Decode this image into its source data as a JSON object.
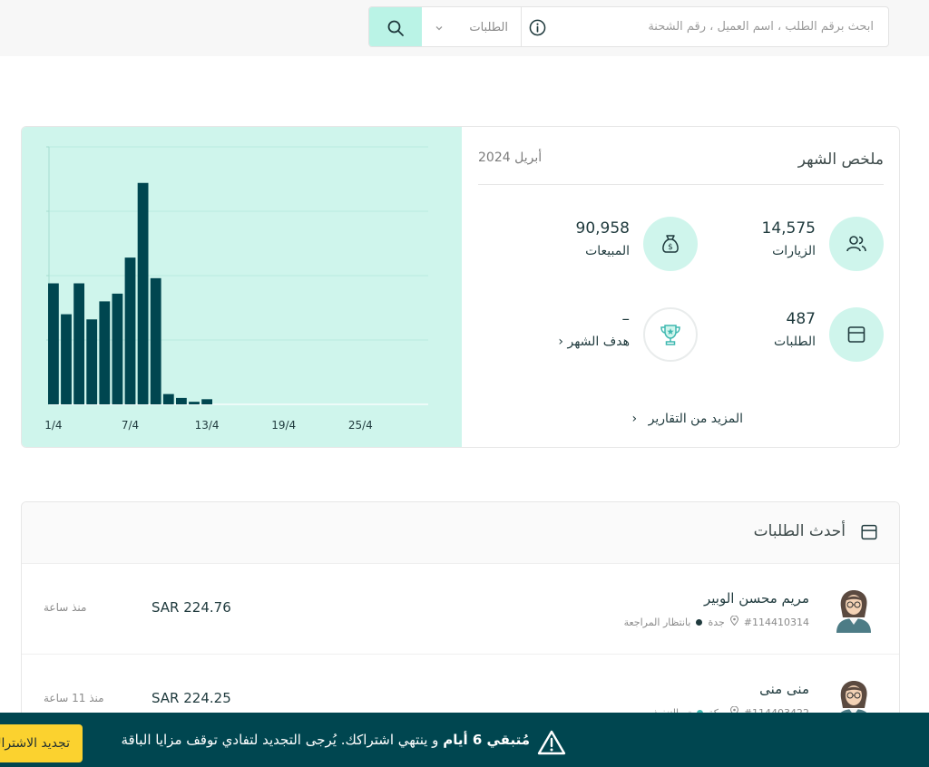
{
  "search": {
    "placeholder": "ابحث برقم الطلب ، اسم العميل ، رقم الشحنة",
    "scope_selected": "الطلبات",
    "button_icon": "search-icon",
    "info_icon": "info-icon"
  },
  "summary": {
    "title": "ملخص الشهر",
    "month": "أبريل 2024",
    "stats": {
      "visits": {
        "value": "14,575",
        "label": "الزيارات",
        "icon": "users-icon"
      },
      "sales": {
        "value": "90,958",
        "label": "المبيعات",
        "icon": "money-bag-icon"
      },
      "orders": {
        "value": "487",
        "label": "الطلبات",
        "icon": "box-icon"
      },
      "goal": {
        "value": "–",
        "label": "هدف الشهر",
        "icon": "trophy-icon"
      }
    },
    "more_reports": "المزيد من التقارير"
  },
  "chart_data": {
    "type": "bar",
    "x_tick_labels": [
      "1/4",
      "7/4",
      "13/4",
      "19/4",
      "25/4"
    ],
    "categories": [
      "1/4",
      "2/4",
      "3/4",
      "4/4",
      "5/4",
      "6/4",
      "7/4",
      "8/4",
      "9/4",
      "10/4",
      "11/4",
      "12/4",
      "13/4"
    ],
    "values": [
      47,
      35,
      47,
      33,
      40,
      43,
      57,
      86,
      49,
      4,
      2.5,
      1,
      2
    ],
    "ylim": [
      0,
      100
    ],
    "bar_color": "#004650",
    "background_color": "#cff5ec",
    "grid": true
  },
  "orders": {
    "title": "أحدث الطلبات",
    "items": [
      {
        "customer": "مريم محسن الوبير",
        "order_no": "#114410314",
        "city": "جدة",
        "status": "بانتظار المراجعة",
        "status_color": "#1f3a3d",
        "amount": "SAR 224.76",
        "time": "منذ ساعة"
      },
      {
        "customer": "منى منى",
        "order_no": "#114403422",
        "city": "مكة",
        "status": "تم التنفيذ",
        "status_color": "#3fb8b0",
        "amount": "SAR 224.25",
        "time": "منذ 11 ساعة"
      }
    ]
  },
  "banner": {
    "msg_bold": "مُتبقي 6 أيام",
    "msg_rest": " و ينتهي اشتراكك. يُرجى التجديد لتفادي توقف مزايا الباقة",
    "button": "تجديد الاشتراك"
  },
  "colors": {
    "primary_dark": "#004650",
    "mint": "#cff5ec",
    "accent_yellow": "#fbd22f"
  }
}
